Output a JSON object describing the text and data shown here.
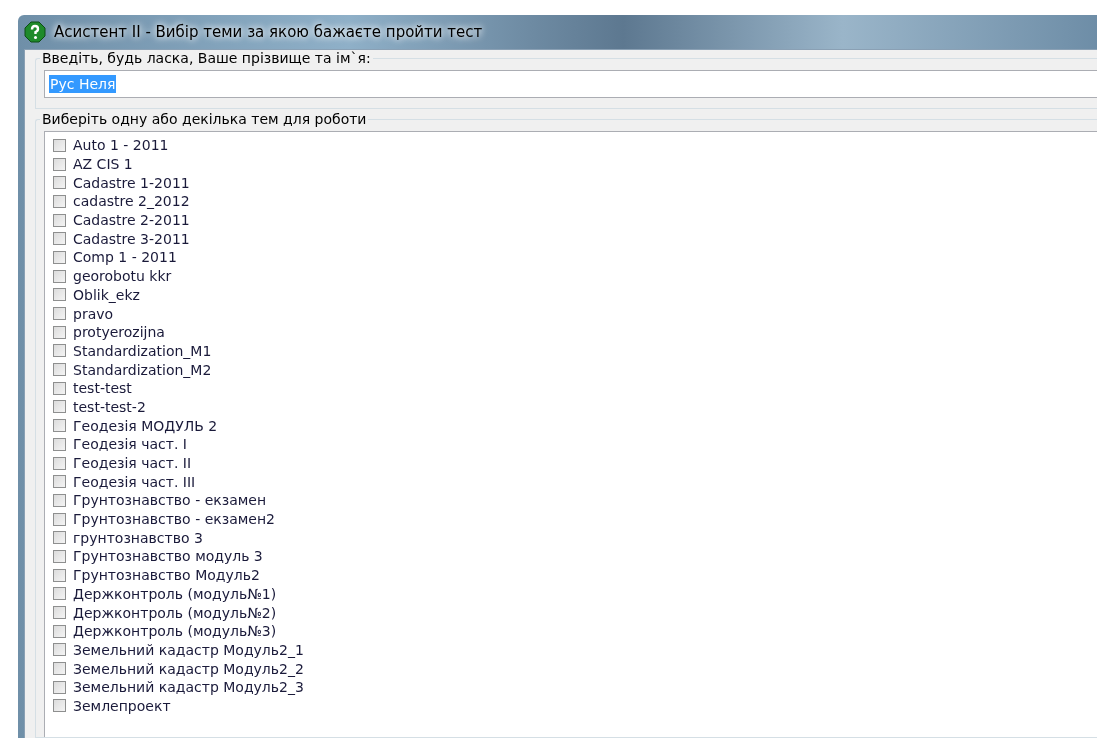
{
  "window": {
    "title": "Асистент II - Вибір теми за якою бажаєте пройти тест"
  },
  "name_group": {
    "label": "Введіть, будь ласка, Ваше прізвище та ім`я:",
    "value": "Рус Неля",
    "value_selected": true
  },
  "topics_group": {
    "label": "Виберіть одну або декілька тем для роботи",
    "items": [
      {
        "label": "Auto 1 - 2011",
        "checked": false
      },
      {
        "label": "AZ CIS 1",
        "checked": false
      },
      {
        "label": "Cadastre 1-2011",
        "checked": false
      },
      {
        "label": "cadastre 2_2012",
        "checked": false
      },
      {
        "label": "Cadastre 2-2011",
        "checked": false
      },
      {
        "label": "Cadastre 3-2011",
        "checked": false
      },
      {
        "label": "Comp 1 - 2011",
        "checked": false
      },
      {
        "label": "georobotu kkr",
        "checked": false
      },
      {
        "label": "Oblik_ekz",
        "checked": false
      },
      {
        "label": "pravo",
        "checked": false
      },
      {
        "label": "protyerozijna",
        "checked": false
      },
      {
        "label": "Standardization_M1",
        "checked": false
      },
      {
        "label": "Standardization_M2",
        "checked": false
      },
      {
        "label": "test-test",
        "checked": false
      },
      {
        "label": "test-test-2",
        "checked": false
      },
      {
        "label": "Геодезія МОДУЛЬ 2",
        "checked": false
      },
      {
        "label": "Геодезія част. I",
        "checked": false
      },
      {
        "label": "Геодезія част. II",
        "checked": false
      },
      {
        "label": "Геодезія част. III",
        "checked": false
      },
      {
        "label": "Грунтознавство - екзамен",
        "checked": false
      },
      {
        "label": "Грунтознавство - екзамен2",
        "checked": false
      },
      {
        "label": "грунтознавство 3",
        "checked": false
      },
      {
        "label": "Грунтознавство модуль 3",
        "checked": false
      },
      {
        "label": "Грунтознавство Модуль2",
        "checked": false
      },
      {
        "label": "Держконтроль (модуль№1)",
        "checked": false
      },
      {
        "label": "Держконтроль (модуль№2)",
        "checked": false
      },
      {
        "label": "Держконтроль (модуль№3)",
        "checked": false
      },
      {
        "label": "Земельний кадастр Модуль2_1",
        "checked": false
      },
      {
        "label": "Земельний кадастр Модуль2_2",
        "checked": false
      },
      {
        "label": "Земельний кадастр Модуль2_3",
        "checked": false
      },
      {
        "label": "Землепроект",
        "checked": false
      }
    ]
  }
}
